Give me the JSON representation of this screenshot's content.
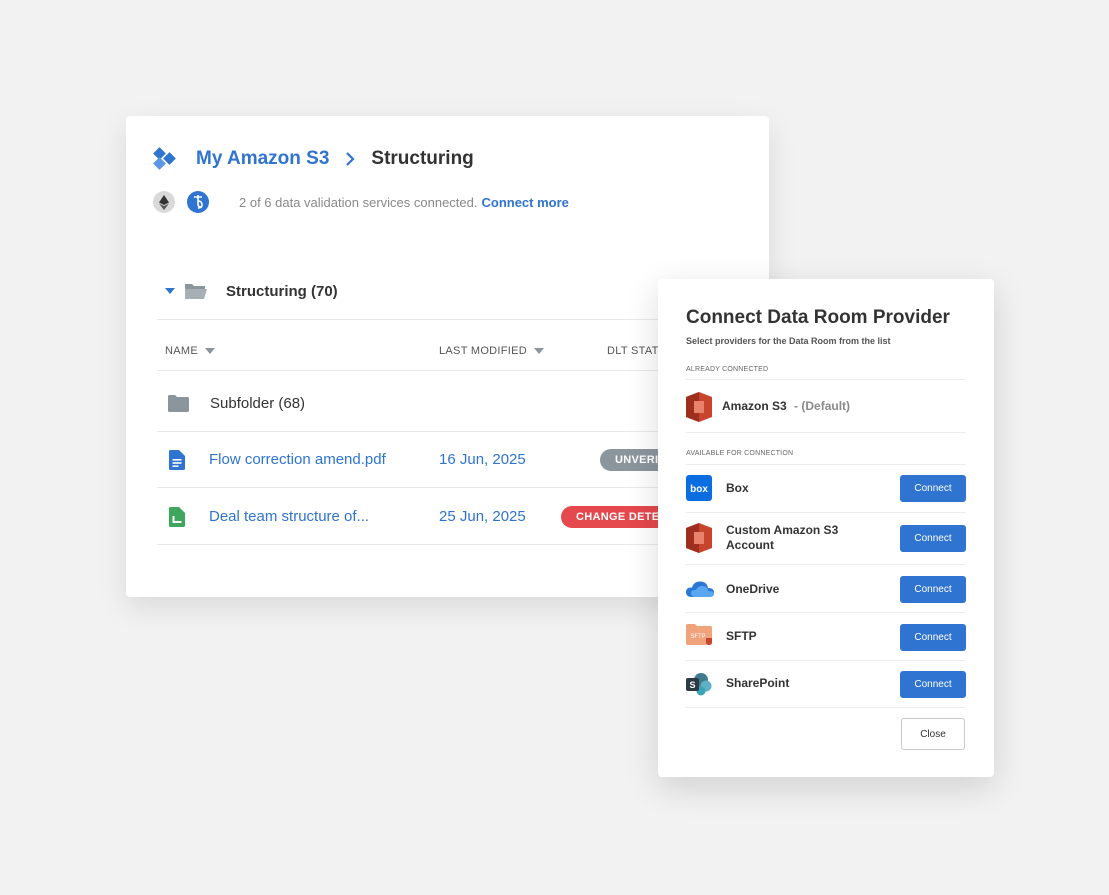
{
  "breadcrumb": {
    "root": "My Amazon S3",
    "current": "Structuring"
  },
  "validation": {
    "status_text": "2 of 6 data validation services connected.",
    "connect_more": "Connect more"
  },
  "folder": {
    "title": "Structuring (70)"
  },
  "table": {
    "columns": [
      "NAME",
      "LAST MODIFIED",
      "DLT STATUS"
    ],
    "rows": [
      {
        "name": "Subfolder (68)",
        "type": "folder-icon",
        "modified": "",
        "status": ""
      },
      {
        "name": "Flow correction amend.pdf",
        "type": "document-icon",
        "modified": "16 Jun, 2025",
        "status": "UNVERIFIED"
      },
      {
        "name": "Deal team structure of...",
        "type": "spreadsheet-icon",
        "modified": "25 Jun, 2025",
        "status": "CHANGE DETECTED"
      }
    ]
  },
  "modal": {
    "title": "Connect Data Room Provider",
    "subtitle": "Select providers for the Data Room from the list",
    "already_connected_label": "ALREADY CONNECTED",
    "connected": {
      "name": "Amazon S3",
      "suffix": "- (Default)"
    },
    "available_label": "AVAILABLE FOR CONNECTION",
    "providers": [
      {
        "name": "Box",
        "icon": "box-icon"
      },
      {
        "name": "Custom Amazon S3 Account",
        "icon": "amazon-s3-icon"
      },
      {
        "name": "OneDrive",
        "icon": "onedrive-icon"
      },
      {
        "name": "SFTP",
        "icon": "sftp-icon"
      },
      {
        "name": "SharePoint",
        "icon": "sharepoint-icon"
      }
    ],
    "connect_label": "Connect",
    "close_label": "Close",
    "sftp_icon_text": "SFTP",
    "box_icon_text": "box"
  },
  "colors": {
    "accent": "#2f74d0",
    "badge_grey": "#8c959c",
    "badge_red": "#e5484d",
    "s3": "#c7452c",
    "sheet_green": "#3fa65e"
  }
}
